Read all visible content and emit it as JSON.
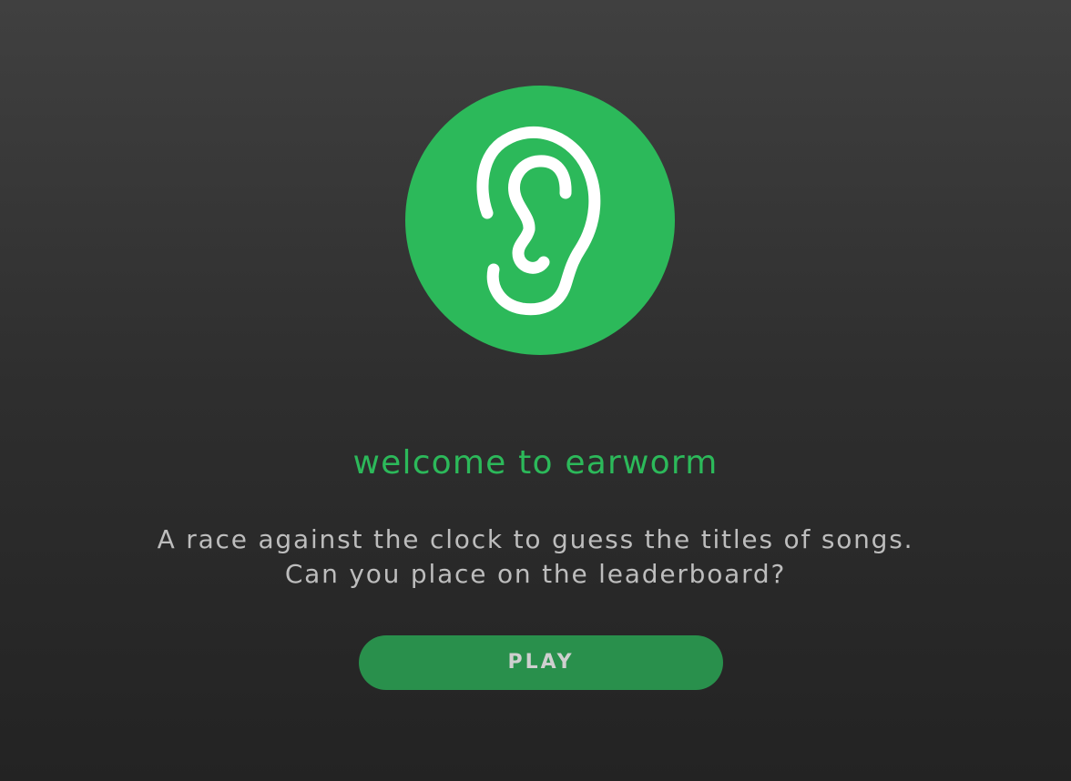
{
  "logo": {
    "icon": "ear-icon",
    "color": "#2cb95a"
  },
  "title": "welcome to earworm",
  "description": {
    "line1": "A race against the clock to guess the titles of songs.",
    "line2": "Can you place on the leaderboard?"
  },
  "play_button": {
    "label": "PLAY",
    "color": "#29904c"
  }
}
